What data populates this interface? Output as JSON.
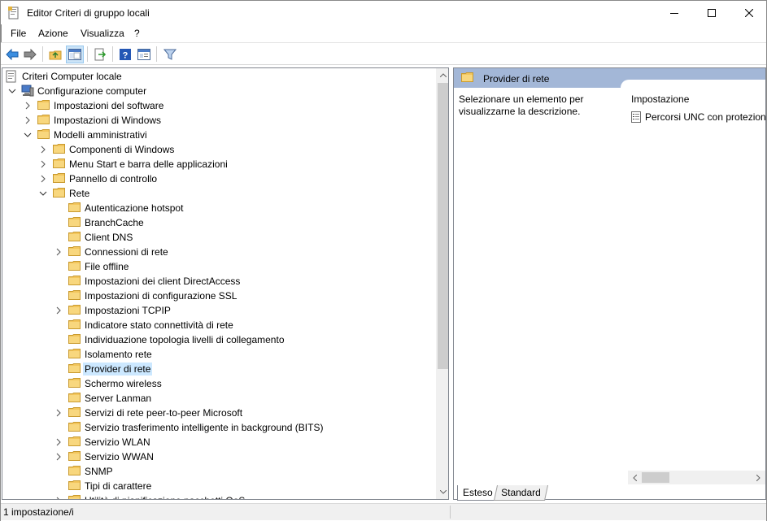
{
  "window": {
    "title": "Editor Criteri di gruppo locali",
    "minimize_icon": "minimize-icon",
    "maximize_icon": "maximize-icon",
    "close_icon": "close-icon"
  },
  "menu": {
    "items": [
      "File",
      "Azione",
      "Visualizza",
      "?"
    ]
  },
  "toolbar": {
    "buttons": [
      {
        "icon": "back-arrow-icon"
      },
      {
        "icon": "forward-arrow-icon"
      },
      {
        "icon": "up-folder-icon"
      },
      {
        "icon": "show-hide-tree-icon",
        "active": true
      },
      {
        "icon": "export-list-icon"
      },
      {
        "icon": "help-icon"
      },
      {
        "icon": "properties-icon"
      },
      {
        "icon": "filter-icon"
      }
    ]
  },
  "tree": {
    "items": [
      {
        "label": "Criteri Computer locale",
        "level": 0,
        "expander": "none",
        "icon": "policy-icon"
      },
      {
        "label": "Configurazione computer",
        "level": 0,
        "expander": "expanded",
        "icon": "computer-icon"
      },
      {
        "label": "Impostazioni del software",
        "level": 1,
        "expander": "collapsed",
        "icon": "folder-icon"
      },
      {
        "label": "Impostazioni di Windows",
        "level": 1,
        "expander": "collapsed",
        "icon": "folder-icon"
      },
      {
        "label": "Modelli amministrativi",
        "level": 1,
        "expander": "expanded",
        "icon": "folder-icon"
      },
      {
        "label": "Componenti di Windows",
        "level": 2,
        "expander": "collapsed",
        "icon": "folder-icon"
      },
      {
        "label": "Menu Start e barra delle applicazioni",
        "level": 2,
        "expander": "collapsed",
        "icon": "folder-icon"
      },
      {
        "label": "Pannello di controllo",
        "level": 2,
        "expander": "collapsed",
        "icon": "folder-icon"
      },
      {
        "label": "Rete",
        "level": 2,
        "expander": "expanded",
        "icon": "folder-icon"
      },
      {
        "label": "Autenticazione hotspot",
        "level": 3,
        "expander": "none",
        "icon": "folder-icon"
      },
      {
        "label": "BranchCache",
        "level": 3,
        "expander": "none",
        "icon": "folder-icon"
      },
      {
        "label": "Client DNS",
        "level": 3,
        "expander": "none",
        "icon": "folder-icon"
      },
      {
        "label": "Connessioni di rete",
        "level": 3,
        "expander": "collapsed",
        "icon": "folder-icon"
      },
      {
        "label": "File offline",
        "level": 3,
        "expander": "none",
        "icon": "folder-icon"
      },
      {
        "label": "Impostazioni dei client DirectAccess",
        "level": 3,
        "expander": "none",
        "icon": "folder-icon"
      },
      {
        "label": "Impostazioni di configurazione SSL",
        "level": 3,
        "expander": "none",
        "icon": "folder-icon"
      },
      {
        "label": "Impostazioni TCPIP",
        "level": 3,
        "expander": "collapsed",
        "icon": "folder-icon"
      },
      {
        "label": "Indicatore stato connettività di rete",
        "level": 3,
        "expander": "none",
        "icon": "folder-icon"
      },
      {
        "label": "Individuazione topologia livelli di collegamento",
        "level": 3,
        "expander": "none",
        "icon": "folder-icon"
      },
      {
        "label": "Isolamento rete",
        "level": 3,
        "expander": "none",
        "icon": "folder-icon"
      },
      {
        "label": "Provider di rete",
        "level": 3,
        "expander": "none",
        "icon": "folder-icon",
        "selected": true
      },
      {
        "label": "Schermo wireless",
        "level": 3,
        "expander": "none",
        "icon": "folder-icon"
      },
      {
        "label": "Server Lanman",
        "level": 3,
        "expander": "none",
        "icon": "folder-icon"
      },
      {
        "label": "Servizi di rete peer-to-peer Microsoft",
        "level": 3,
        "expander": "collapsed",
        "icon": "folder-icon"
      },
      {
        "label": "Servizio trasferimento intelligente in background (BITS)",
        "level": 3,
        "expander": "none",
        "icon": "folder-icon"
      },
      {
        "label": "Servizio WLAN",
        "level": 3,
        "expander": "collapsed",
        "icon": "folder-icon"
      },
      {
        "label": "Servizio WWAN",
        "level": 3,
        "expander": "collapsed",
        "icon": "folder-icon"
      },
      {
        "label": "SNMP",
        "level": 3,
        "expander": "none",
        "icon": "folder-icon"
      },
      {
        "label": "Tipi di carattere",
        "level": 3,
        "expander": "none",
        "icon": "folder-icon"
      },
      {
        "label": "Utilità di pianificazione pacchetti QoS",
        "level": 3,
        "expander": "collapsed",
        "icon": "folder-icon"
      }
    ]
  },
  "details": {
    "header_title": "Provider di rete",
    "description": "Selezionare un elemento per visualizzarne la descrizione.",
    "column_header": "Impostazione",
    "items": [
      {
        "label": "Percorsi UNC con protezione avanzata",
        "icon": "setting-icon"
      }
    ]
  },
  "tabs": {
    "extended": "Esteso",
    "standard": "Standard"
  },
  "status": {
    "text": "1 impostazione/i"
  },
  "colors": {
    "selection": "#cce8ff",
    "header_band": "#a3b7d7",
    "folder": "#f2c55c"
  }
}
